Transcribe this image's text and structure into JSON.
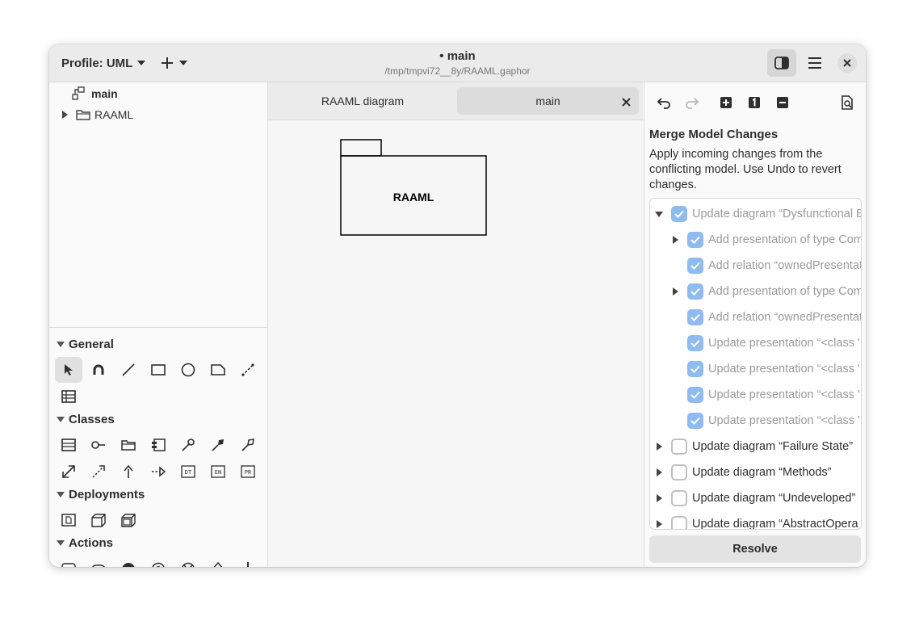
{
  "header": {
    "profile_label": "Profile: UML",
    "title": "main",
    "title_dot": "•",
    "subtitle": "/tmp/tmpvi72__8y/RAAML.gaphor"
  },
  "tree": {
    "items": [
      {
        "label": "main",
        "icon": "diagram-icon",
        "bold": true
      },
      {
        "label": "RAAML",
        "icon": "package-icon",
        "bold": false
      }
    ]
  },
  "toolbox": {
    "sections": [
      {
        "title": "General"
      },
      {
        "title": "Classes"
      },
      {
        "title": "Deployments"
      },
      {
        "title": "Actions"
      }
    ]
  },
  "tabs": [
    {
      "label": "RAAML diagram"
    },
    {
      "label": "main"
    }
  ],
  "canvas": {
    "package_label": "RAAML"
  },
  "merge": {
    "title": "Merge Model Changes",
    "description": "Apply incoming changes from the conflicting model. Use Undo to revert changes.",
    "changes": [
      {
        "label": "Update diagram “Dysfunctional B",
        "checked": true,
        "dim": true,
        "expander": "down"
      },
      {
        "label": "Add presentation of type Com",
        "checked": true,
        "dim": true,
        "expander": "right"
      },
      {
        "label": "Add relation “ownedPresentat",
        "checked": true,
        "dim": true,
        "expander": "none"
      },
      {
        "label": "Add presentation of type Com",
        "checked": true,
        "dim": true,
        "expander": "right"
      },
      {
        "label": "Add relation “ownedPresentat",
        "checked": true,
        "dim": true,
        "expander": "none"
      },
      {
        "label": "Update presentation “<class '",
        "checked": true,
        "dim": true,
        "expander": "none"
      },
      {
        "label": "Update presentation “<class '",
        "checked": true,
        "dim": true,
        "expander": "none"
      },
      {
        "label": "Update presentation “<class '",
        "checked": true,
        "dim": true,
        "expander": "none"
      },
      {
        "label": "Update presentation “<class '",
        "checked": true,
        "dim": true,
        "expander": "none"
      },
      {
        "label": "Update diagram “Failure State”",
        "checked": false,
        "dim": false,
        "expander": "right"
      },
      {
        "label": "Update diagram “Methods”",
        "checked": false,
        "dim": false,
        "expander": "right"
      },
      {
        "label": "Update diagram “Undeveloped”",
        "checked": false,
        "dim": false,
        "expander": "right"
      },
      {
        "label": "Update diagram “AbstractOpera",
        "checked": false,
        "dim": false,
        "expander": "right"
      }
    ],
    "resolve_label": "Resolve"
  },
  "colors": {
    "accent": "#3584e4",
    "header_bg": "#ebebeb",
    "canvas_bg": "#f6f6f6"
  }
}
